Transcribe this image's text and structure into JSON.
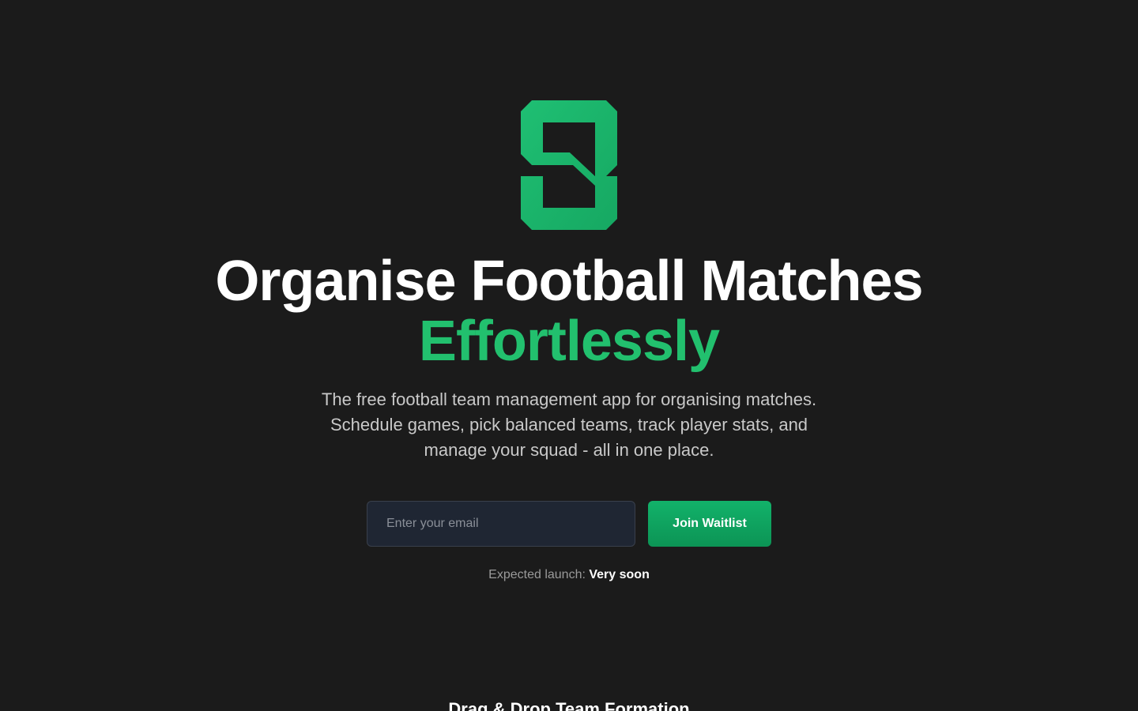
{
  "brand": {
    "logo_icon": "s-shield-logo-icon",
    "accent_color": "#22c06e"
  },
  "hero": {
    "title_line1": "Organise Football Matches",
    "title_line2": "Effortlessly",
    "subtitle": "The free football team management app for organising matches. Schedule games, pick balanced teams, track player stats, and manage your squad - all in one place."
  },
  "waitlist": {
    "email_placeholder": "Enter your email",
    "email_value": "",
    "join_label": "Join Waitlist",
    "launch_label": "Expected launch: ",
    "launch_value": "Very soon"
  },
  "features": {
    "first_heading": "Drag & Drop Team Formation"
  }
}
